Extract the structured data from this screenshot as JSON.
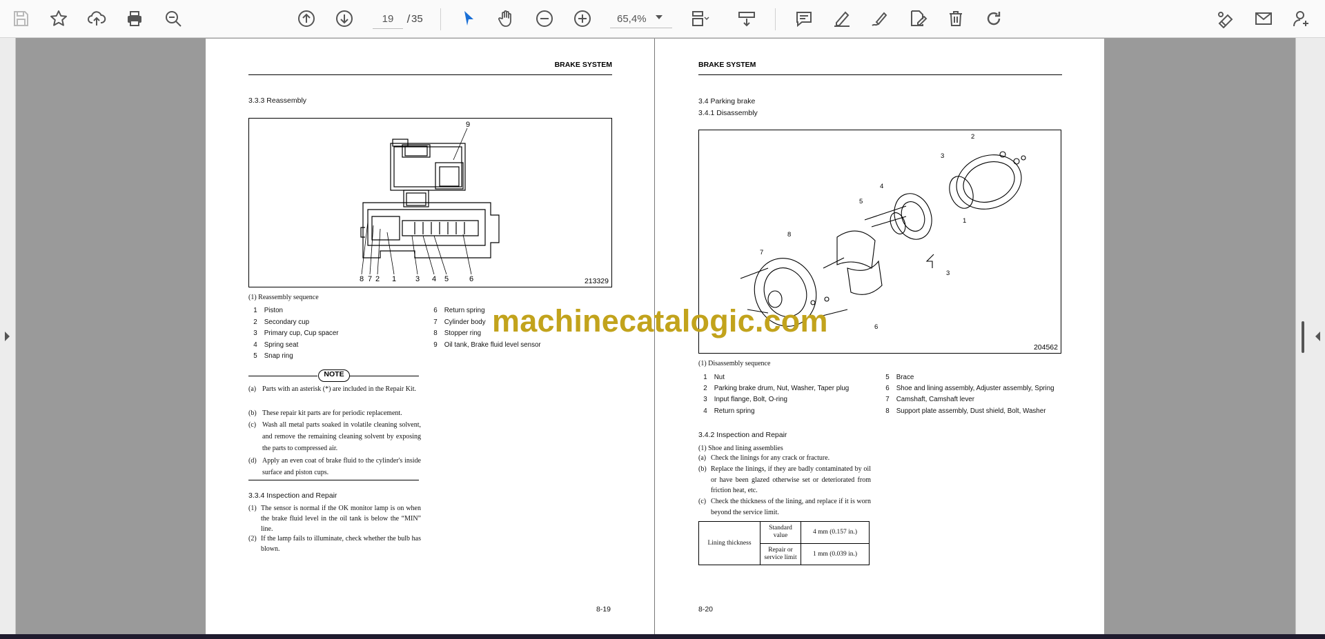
{
  "toolbar": {
    "page_current": "19",
    "page_separator": "/",
    "page_total": "35",
    "zoom": "65,4%",
    "icons": [
      "save-icon",
      "bookmark-star-icon",
      "upload-cloud-icon",
      "print-icon",
      "zoom-search-icon",
      "page-up-icon",
      "page-down-icon",
      "select-cursor-icon",
      "hand-pan-icon",
      "zoom-out-icon",
      "zoom-in-icon",
      "fit-page-icon",
      "scroll-mode-icon",
      "comment-icon",
      "highlight-pen-icon",
      "draw-icon",
      "edit-pdf-icon",
      "delete-icon",
      "rotate-icon",
      "sign-icon",
      "email-icon",
      "add-user-icon"
    ],
    "accent_color": "#1a6fd6"
  },
  "watermark": "machinecatalogic.com",
  "left_page": {
    "header": "BRAKE SYSTEM",
    "section_title": "3.3.3   Reassembly",
    "figure_number": "213329",
    "figure_callouts": [
      "9",
      "8",
      "7",
      "2",
      "1",
      "3",
      "4",
      "5",
      "6"
    ],
    "legend_title": "(1)  Reassembly sequence",
    "legend_left": [
      {
        "num": "1",
        "text": "Piston"
      },
      {
        "num": "2",
        "text": "Secondary cup"
      },
      {
        "num": "3",
        "text": "Primary cup, Cup spacer"
      },
      {
        "num": "4",
        "text": "Spring seat"
      },
      {
        "num": "5",
        "text": "Snap ring"
      }
    ],
    "legend_right": [
      {
        "num": "6",
        "text": "Return spring"
      },
      {
        "num": "7",
        "text": "Cylinder body"
      },
      {
        "num": "8",
        "text": "Stopper ring"
      },
      {
        "num": "9",
        "text": "Oil tank, Brake fluid level sensor"
      }
    ],
    "note_label": "NOTE",
    "notes": [
      {
        "mark": "(a)",
        "text": "Parts with an asterisk (*) are included in the Repair Kit."
      },
      {
        "mark": "(b)",
        "text": "These repair kit parts are for periodic replacement."
      },
      {
        "mark": "(c)",
        "text": "Wash all metal parts soaked in volatile cleaning solvent, and remove the remaining cleaning solvent by exposing the parts to compressed air."
      },
      {
        "mark": "(d)",
        "text": "Apply an even coat of brake fluid to the cylinder's inside surface and piston cups."
      }
    ],
    "subsection_title": "3.3.4   Inspection and Repair",
    "items": [
      {
        "mark": "(1)",
        "text": "The sensor is normal if the OK monitor lamp is on when the brake fluid level in the oil tank is below the “MIN” line."
      },
      {
        "mark": "(2)",
        "text": "If the lamp fails to illuminate, check whether the bulb has blown."
      }
    ],
    "page_number": "8-19"
  },
  "right_page": {
    "header": "BRAKE SYSTEM",
    "section_title": "3.4   Parking brake",
    "subsection_title": "3.4.1   Disassembly",
    "figure_number": "204562",
    "figure_callouts": [
      "2",
      "3",
      "4",
      "5",
      "6",
      "7",
      "8",
      "1",
      "3"
    ],
    "legend_title": "(1)  Disassembly sequence",
    "legend_left": [
      {
        "num": "1",
        "text": "Nut"
      },
      {
        "num": "2",
        "text": "Parking brake drum, Nut, Washer, Taper plug"
      },
      {
        "num": "3",
        "text": "Input flange, Bolt, O-ring"
      },
      {
        "num": "4",
        "text": "Return spring"
      }
    ],
    "legend_right": [
      {
        "num": "5",
        "text": "Brace"
      },
      {
        "num": "6",
        "text": "Shoe and lining assembly, Adjuster assembly, Spring"
      },
      {
        "num": "7",
        "text": "Camshaft, Camshaft lever"
      },
      {
        "num": "8",
        "text": "Support plate assembly, Dust shield, Bolt, Washer"
      }
    ],
    "subsection2_title": "3.4.2   Inspection and Repair",
    "sub_item_title": "(1)  Shoe and lining assemblies",
    "items": [
      {
        "mark": "(a)",
        "text": "Check the linings for any crack or fracture."
      },
      {
        "mark": "(b)",
        "text": "Replace the linings, if they are badly contaminated by oil or have been glazed otherwise set or deteriorated from friction heat, etc."
      },
      {
        "mark": "(c)",
        "text": "Check the thickness of the lining, and replace if it is worn beyond the service limit."
      }
    ],
    "table": {
      "row_header": "Lining thickness",
      "rows": [
        {
          "label": "Standard value",
          "value": "4 mm (0.157 in.)"
        },
        {
          "label": "Repair or service limit",
          "value": "1 mm (0.039 in.)"
        }
      ]
    },
    "page_number": "8-20"
  }
}
